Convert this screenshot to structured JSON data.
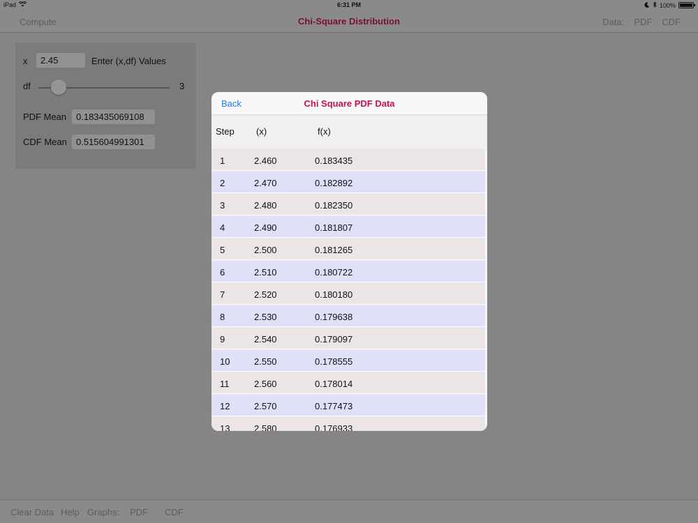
{
  "status": {
    "device": "iPad",
    "time": "6:31 PM",
    "battery": "100%"
  },
  "nav": {
    "compute": "Compute",
    "title": "Chi-Square Distribution",
    "data_label": "Data:",
    "pdf": "PDF",
    "cdf": "CDF"
  },
  "panel": {
    "x_label": "x",
    "x_value": "2.45",
    "enter_label": "Enter (x,df) Values",
    "df_label": "df",
    "df_value": "3",
    "pdf_mean_label": "PDF Mean",
    "pdf_mean_value": "0.183435069108",
    "cdf_mean_label": "CDF Mean",
    "cdf_mean_value": "0.515604991301"
  },
  "modal": {
    "back": "Back",
    "title": "Chi Square PDF Data",
    "headers": [
      "Step",
      "(x)",
      "f(x)"
    ],
    "rows": [
      [
        "1",
        "2.460",
        "0.183435"
      ],
      [
        "2",
        "2.470",
        "0.182892"
      ],
      [
        "3",
        "2.480",
        "0.182350"
      ],
      [
        "4",
        "2.490",
        "0.181807"
      ],
      [
        "5",
        "2.500",
        "0.181265"
      ],
      [
        "6",
        "2.510",
        "0.180722"
      ],
      [
        "7",
        "2.520",
        "0.180180"
      ],
      [
        "8",
        "2.530",
        "0.179638"
      ],
      [
        "9",
        "2.540",
        "0.179097"
      ],
      [
        "10",
        "2.550",
        "0.178555"
      ],
      [
        "11",
        "2.560",
        "0.178014"
      ],
      [
        "12",
        "2.570",
        "0.177473"
      ],
      [
        "13",
        "2.580",
        "0.176933"
      ]
    ]
  },
  "toolbar": {
    "clear": "Clear Data",
    "help": "Help",
    "graphs": "Graphs:",
    "pdf": "PDF",
    "cdf": "CDF"
  }
}
